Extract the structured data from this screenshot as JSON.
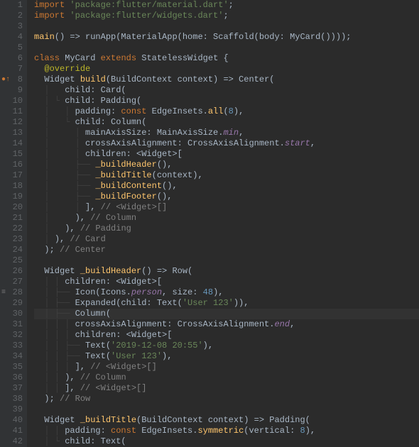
{
  "lines": [
    {
      "n": 1,
      "mark": "",
      "html": "<span class='kw'>import </span><span class='str'>'package:flutter/material.dart'</span><span class='punc'>;</span>"
    },
    {
      "n": 2,
      "mark": "",
      "html": "<span class='kw'>import </span><span class='str'>'package:flutter/widgets.dart'</span><span class='punc'>;</span>"
    },
    {
      "n": 3,
      "mark": "",
      "html": ""
    },
    {
      "n": 4,
      "mark": "",
      "html": "<span class='fn'>main</span>() =&gt; runApp(MaterialApp(home: Scaffold(body: MyCard())));"
    },
    {
      "n": 5,
      "mark": "",
      "html": ""
    },
    {
      "n": 6,
      "mark": "",
      "html": "<span class='kw'>class </span>MyCard <span class='kw'>extends </span>StatelessWidget {"
    },
    {
      "n": 7,
      "mark": "",
      "html": "  <span class='meta'>@override</span>"
    },
    {
      "n": 8,
      "mark": "o",
      "html": "  Widget <span class='fn'>build</span>(BuildContext context) =&gt; Center("
    },
    {
      "n": 9,
      "mark": "",
      "html": "<span class='guide'>  │   </span>child: Card("
    },
    {
      "n": 10,
      "mark": "",
      "html": "<span class='guide'>  │ └ </span>child: Padding("
    },
    {
      "n": 11,
      "mark": "",
      "html": "<span class='guide'>  │   │ </span>padding: <span class='kw'>const </span>EdgeInsets.<span class='fn'>all</span>(<span class='num'>8</span>),"
    },
    {
      "n": 12,
      "mark": "",
      "html": "<span class='guide'>  │   └ </span>child: Column("
    },
    {
      "n": 13,
      "mark": "",
      "html": "<span class='guide'>  │     │ </span>mainAxisSize: MainAxisSize.<span class='ital'>min</span>,"
    },
    {
      "n": 14,
      "mark": "",
      "html": "<span class='guide'>  │     │ </span>crossAxisAlignment: CrossAxisAlignment.<span class='ital'>start</span>,"
    },
    {
      "n": 15,
      "mark": "",
      "html": "<span class='guide'>  │     │ </span>children: &lt;Widget&gt;["
    },
    {
      "n": 16,
      "mark": "",
      "html": "<span class='guide'>  │     ├── </span><span class='fn'>_buildHeader</span>(),"
    },
    {
      "n": 17,
      "mark": "",
      "html": "<span class='guide'>  │     ├── </span><span class='fn'>_buildTitle</span>(context),"
    },
    {
      "n": 18,
      "mark": "",
      "html": "<span class='guide'>  │     ├── </span><span class='fn'>_buildContent</span>(),"
    },
    {
      "n": 19,
      "mark": "",
      "html": "<span class='guide'>  │     ├── </span><span class='fn'>_buildFooter</span>(),"
    },
    {
      "n": 20,
      "mark": "",
      "html": "<span class='guide'>  │     │ </span>], <span class='comment'>// &lt;Widget&gt;[]</span>"
    },
    {
      "n": 21,
      "mark": "",
      "html": "<span class='guide'>  │     </span>), <span class='comment'>// Column</span>"
    },
    {
      "n": 22,
      "mark": "",
      "html": "<span class='guide'>  │   </span>), <span class='comment'>// Padding</span>"
    },
    {
      "n": 23,
      "mark": "",
      "html": "<span class='guide'>  │ </span>), <span class='comment'>// Card</span>"
    },
    {
      "n": 24,
      "mark": "",
      "html": "  ); <span class='comment'>// Center</span>"
    },
    {
      "n": 25,
      "mark": "",
      "html": ""
    },
    {
      "n": 26,
      "mark": "",
      "html": "  Widget <span class='fn'>_buildHeader</span>() =&gt; Row("
    },
    {
      "n": 27,
      "mark": "",
      "html": "<span class='guide'>  │ │ </span>children: &lt;Widget&gt;["
    },
    {
      "n": 28,
      "mark": "u",
      "html": "<span class='guide'>  │ ├── </span>Icon(Icons.<span class='ital'>person</span>, size: <span class='num'>48</span>),"
    },
    {
      "n": 29,
      "mark": "",
      "html": "<span class='guide'>  │ ├── </span>Expanded(child: Text(<span class='str'>'User 123'</span>)),"
    },
    {
      "n": 30,
      "mark": "",
      "hl": true,
      "html": "<span class='guide'>  │ ├── </span>Column("
    },
    {
      "n": 31,
      "mark": "",
      "html": "<span class='guide'>  │ │ │ </span>crossAxisAlignment: CrossAxisAlignment.<span class='ital'>end</span>,"
    },
    {
      "n": 32,
      "mark": "",
      "html": "<span class='guide'>  │ │ │ </span>children: &lt;Widget&gt;["
    },
    {
      "n": 33,
      "mark": "",
      "html": "<span class='guide'>  │ │ ├── </span>Text(<span class='str'>'2019-12-08 20:55'</span>),"
    },
    {
      "n": 34,
      "mark": "",
      "html": "<span class='guide'>  │ │ ├── </span>Text(<span class='str'>'User 123'</span>),"
    },
    {
      "n": 35,
      "mark": "",
      "html": "<span class='guide'>  │ │ │ </span>], <span class='comment'>// &lt;Widget&gt;[]</span>"
    },
    {
      "n": 36,
      "mark": "",
      "html": "<span class='guide'>  │ │ </span>), <span class='comment'>// Column</span>"
    },
    {
      "n": 37,
      "mark": "",
      "html": "<span class='guide'>  │ │ </span>], <span class='comment'>// &lt;Widget&gt;[]</span>"
    },
    {
      "n": 38,
      "mark": "",
      "html": "  ); <span class='comment'>// Row</span>"
    },
    {
      "n": 39,
      "mark": "",
      "html": ""
    },
    {
      "n": 40,
      "mark": "",
      "html": "  Widget <span class='fn'>_buildTitle</span>(BuildContext context) =&gt; Padding("
    },
    {
      "n": 41,
      "mark": "",
      "html": "<span class='guide'>  │ │ </span>padding: <span class='kw'>const </span>EdgeInsets.<span class='fn'>symmetric</span>(vertical: <span class='num'>8</span>),"
    },
    {
      "n": 42,
      "mark": "",
      "html": "<span class='guide'>  │ └ </span>child: Text("
    }
  ],
  "gutter_marks": {
    "o": "●↑",
    "u": "👤"
  }
}
